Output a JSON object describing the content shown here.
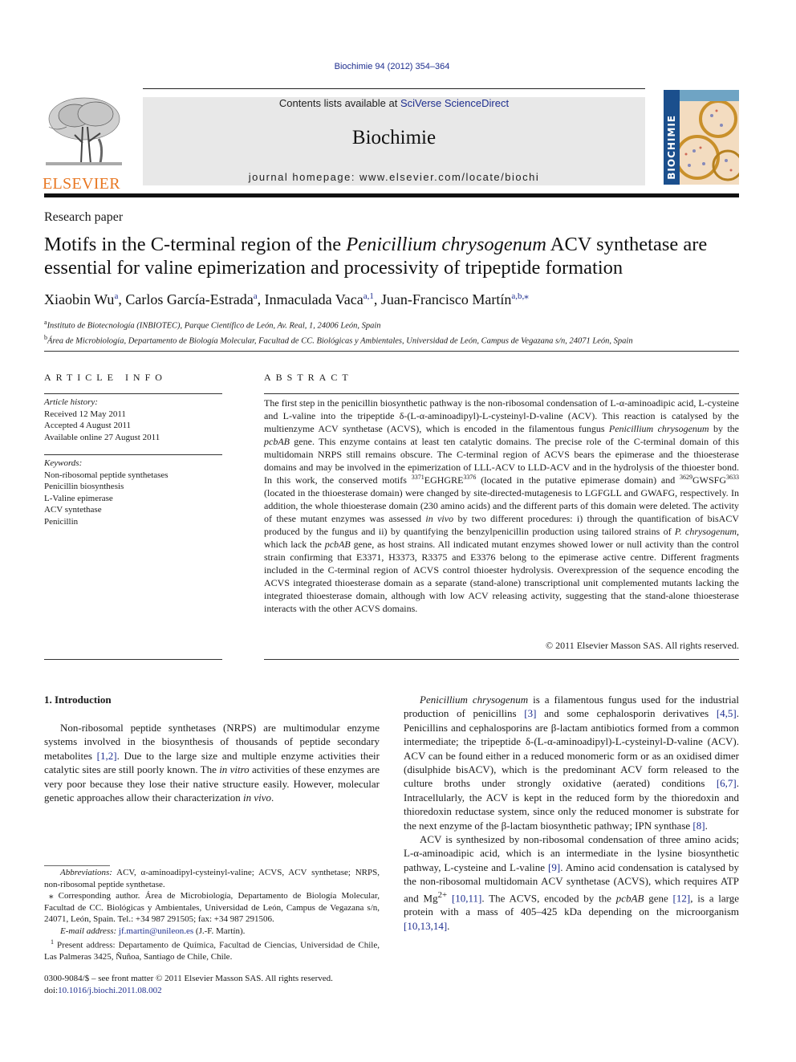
{
  "header": {
    "citation": "Biochimie 94 (2012) 354–364",
    "contents_prefix": "Contents lists available at ",
    "contents_link": "SciVerse ScienceDirect",
    "journal_name": "Biochimie",
    "homepage": "journal homepage: www.elsevier.com/locate/biochi",
    "publisher_logo_text": "ELSEVIER",
    "cover_title": "BIOCHIMIE",
    "colors": {
      "link": "#1e2e8f",
      "elsevier_orange": "#e87722",
      "masthead_bg": "#e8e8e8",
      "cover_blue": "#1b4f8d"
    }
  },
  "article": {
    "type": "Research paper",
    "title_part1": "Motifs in the C-terminal region of the ",
    "title_italic": "Penicillium chrysogenum",
    "title_part2": " ACV synthetase are essential for valine epimerization and processivity of tripeptide formation",
    "authors": [
      {
        "name": "Xiaobin Wu",
        "sup": "a"
      },
      {
        "name": "Carlos García-Estrada",
        "sup": "a"
      },
      {
        "name": "Inmaculada Vaca",
        "sup": "a,1"
      },
      {
        "name": "Juan-Francisco Martín",
        "sup": "a,b,⁎"
      }
    ],
    "affiliations": [
      {
        "key": "a",
        "text": "Instituto de Biotecnología (INBIOTEC), Parque Científico de León, Av. Real, 1, 24006 León, Spain"
      },
      {
        "key": "b",
        "text": "Área de Microbiología, Departamento de Biología Molecular, Facultad de CC. Biológicas y Ambientales, Universidad de León, Campus de Vegazana s/n, 24071 León, Spain"
      }
    ]
  },
  "article_info": {
    "heading": "ARTICLE INFO",
    "history_label": "Article history:",
    "history": [
      "Received 12 May 2011",
      "Accepted 4 August 2011",
      "Available online 27 August 2011"
    ],
    "keywords_label": "Keywords:",
    "keywords": [
      "Non-ribosomal peptide synthetases",
      "Penicillin biosynthesis",
      "L-Valine epimerase",
      "ACV syntethase",
      "Penicillin"
    ]
  },
  "abstract": {
    "heading": "ABSTRACT",
    "segments": {
      "s1": "The first step in the penicillin biosynthetic pathway is the non-ribosomal condensation of L-α-aminoadipic acid, L-cysteine and L-valine into the tripeptide δ-(L-α-aminoadipyl)-L-cysteinyl-D-valine (ACV). This reaction is catalysed by the multienzyme ACV synthetase (ACVS), which is encoded in the filamentous fungus ",
      "s1_italic": "Penicillium chrysogenum",
      "s2": " by the ",
      "s2_italic": "pcbAB",
      "s3": " gene. This enzyme contains at least ten catalytic domains. The precise role of the C-terminal domain of this multidomain NRPS still remains obscure. The C-terminal region of ACVS bears the epimerase and the thioesterase domains and may be involved in the epimerization of LLL-ACV to LLD-ACV and in the hydrolysis of the thioester bond. In this work, the conserved motifs ",
      "m1_start": "3371",
      "m1": "EGHGRE",
      "m1_end": "3376",
      "s4": " (located in the putative epimerase domain) and ",
      "m2_start": "3629",
      "m2": "GWSFG",
      "m2_end": "3633",
      "s5": " (located in the thioesterase domain) were changed by site-directed-mutagenesis to LGFGLL and GWAFG, respectively. In addition, the whole thioesterase domain (230 amino acids) and the different parts of this domain were deleted. The activity of these mutant enzymes was assessed ",
      "s5_italic": "in vivo",
      "s6": " by two different procedures: i) through the quantification of bisACV produced by the fungus and ii) by quantifying the benzylpenicillin production using tailored strains of ",
      "s6_italic": "P. chrysogenum",
      "s7": ", which lack the ",
      "s7_italic": "pcbAB",
      "s8": " gene, as host strains. All indicated mutant enzymes showed lower or null activity than the control strain confirming that E3371, H3373, R3375 and E3376 belong to the epimerase active centre. Different fragments included in the C-terminal region of ACVS control thioester hydrolysis. Overexpression of the sequence encoding the ACVS integrated thioesterase domain as a separate (stand-alone) transcriptional unit complemented mutants lacking the integrated thioesterase domain, although with low ACV releasing activity, suggesting that the stand-alone thioesterase interacts with the other ACVS domains."
    },
    "copyright": "© 2011 Elsevier Masson SAS. All rights reserved."
  },
  "introduction": {
    "heading": "1.  Introduction",
    "col1_p1": {
      "a": "Non-ribosomal peptide synthetases (NRPS) are multimodular enzyme systems involved in the biosynthesis of thousands of peptide secondary metabolites ",
      "ref1": "[1,2]",
      "b": ". Due to the large size and multiple enzyme activities their catalytic sites are still poorly known. The ",
      "i1": "in vitro",
      "c": " activities of these enzymes are very poor because they lose their native structure easily. However, molecular genetic approaches allow their characterization ",
      "i2": "in vivo",
      "d": "."
    },
    "col2_p1": {
      "i0": "Penicillium chrysogenum",
      "a": " is a filamentous fungus used for the industrial production of penicillins ",
      "ref1": "[3]",
      "b": " and some cephalosporin derivatives ",
      "ref2": "[4,5]",
      "c": ". Penicillins and cephalosporins are β-lactam antibiotics formed from a common intermediate; the tripeptide δ-(L-α-aminoadipyl)-L-cysteinyl-D-valine (ACV). ACV can be found either in a reduced monomeric form or as an oxidised dimer (disulphide bisACV), which is the predominant ACV form released to the culture broths under strongly oxidative (aerated) conditions ",
      "ref3": "[6,7]",
      "d": ". Intracellularly, the ACV is kept in the reduced form by the thioredoxin and thioredoxin reductase system, since only the reduced monomer is substrate for the next enzyme of the β-lactam biosynthetic pathway; IPN synthase ",
      "ref4": "[8]",
      "e": "."
    },
    "col2_p2": {
      "a": "ACV is synthesized by non-ribosomal condensation of three amino acids; L-α-aminoadipic acid, which is an intermediate in the lysine biosynthetic pathway, L-cysteine and L-valine ",
      "ref1": "[9]",
      "b": ". Amino acid condensation is catalysed by the non-ribosomal multidomain ACV synthetase (ACVS), which requires ATP and Mg",
      "sup": "2+",
      "c": " ",
      "ref2": "[10,11]",
      "d": ". The ACVS, encoded by the ",
      "i1": "pcbAB",
      "e": " gene ",
      "ref3": "[12]",
      "f": ", is a large protein with a mass of 405–425 kDa depending on the microorganism ",
      "ref4": "[10,13,14]",
      "g": "."
    }
  },
  "footnotes": {
    "abbrev_label": "Abbreviations:",
    "abbrev_text": " ACV, α-aminoadipyl-cysteinyl-valine; ACVS, ACV synthetase; NRPS, non-ribosomal peptide synthetase.",
    "corresponding_mark": "⁎",
    "corresponding": " Corresponding author. Área de Microbiología, Departamento de Biología Molecular, Facultad de CC. Biológicas y Ambientales, Universidad de León, Campus de Vegazana s/n, 24071, León, Spain. Tel.: +34 987 291505; fax: +34 987 291506.",
    "email_label": "E-mail address:",
    "email": "jf.martin@unileon.es",
    "email_suffix": " (J.-F. Martín).",
    "present_mark": "1",
    "present": " Present address: Departamento de Química, Facultad de Ciencias, Universidad de Chile, Las Palmeras 3425, Ñuñoa, Santiago de Chile, Chile.",
    "front_matter": "0300-9084/$ – see front matter © 2011 Elsevier Masson SAS. All rights reserved.",
    "doi_label": "doi:",
    "doi": "10.1016/j.biochi.2011.08.002"
  }
}
